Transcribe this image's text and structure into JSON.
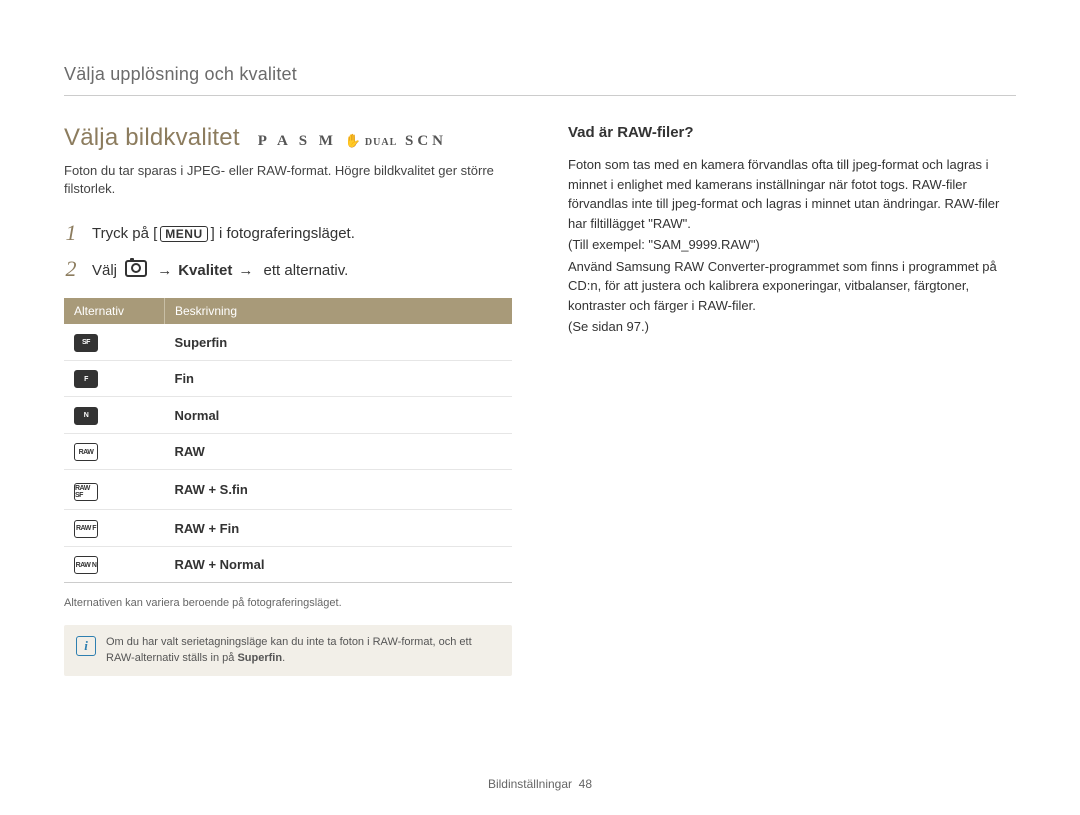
{
  "header": "Välja upplösning och kvalitet",
  "section": {
    "title": "Välja bildkvalitet",
    "modes_main": "P A S M",
    "modes_hand": "✋",
    "modes_dual": "DUAL",
    "modes_scn": "SCN"
  },
  "lead": "Foton du tar sparas i JPEG- eller RAW-format. Högre bildkvalitet ger större filstorlek.",
  "steps": [
    {
      "num": "1",
      "pre": "Tryck på [",
      "menu": "MENU",
      "post": "] i fotograferingsläget."
    },
    {
      "num": "2",
      "pre": "Välj ",
      "arrow": "→",
      "kvalitet": "Kvalitet",
      "post": " ett alternativ."
    }
  ],
  "table": {
    "head_alt": "Alternativ",
    "head_desc": "Beskrivning",
    "rows": [
      {
        "icon": "SF",
        "filled": true,
        "desc": "Superfin"
      },
      {
        "icon": "F",
        "filled": true,
        "desc": "Fin"
      },
      {
        "icon": "N",
        "filled": true,
        "desc": "Normal"
      },
      {
        "icon": "RAW",
        "filled": false,
        "desc": "RAW"
      },
      {
        "icon": "RAW SF",
        "filled": false,
        "desc": "RAW + S.fin"
      },
      {
        "icon": "RAW F",
        "filled": false,
        "desc": "RAW + Fin"
      },
      {
        "icon": "RAW N",
        "filled": false,
        "desc": "RAW + Normal"
      }
    ]
  },
  "footnote": "Alternativen kan variera beroende på fotograferingsläget.",
  "note": {
    "text_pre": "Om du har valt serietagningsläge kan du inte ta foton i RAW-format, och ett RAW-alternativ ställs in på ",
    "bold": "Superfin",
    "text_post": "."
  },
  "right": {
    "title": "Vad är RAW-filer?",
    "p1": "Foton som tas med en kamera förvandlas ofta till jpeg-format och lagras i minnet i enlighet med kamerans inställningar när fotot togs. RAW-filer förvandlas inte till jpeg-format och lagras i minnet utan ändringar. RAW-filer har filtillägget \"RAW\".",
    "p2": "(Till exempel: \"SAM_9999.RAW\")",
    "p3": "Använd Samsung RAW Converter-programmet som finns i programmet på CD:n, för att justera och kalibrera exponeringar, vitbalanser, färgtoner, kontraster och färger i RAW-filer.",
    "p4": "(Se sidan 97.)"
  },
  "footer": {
    "section": "Bildinställningar",
    "page": "48"
  }
}
